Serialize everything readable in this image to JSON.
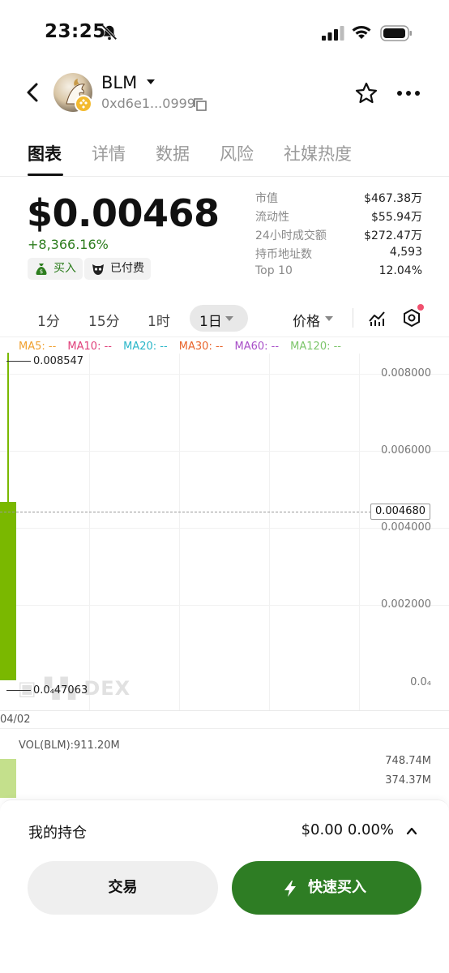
{
  "status_bar": {
    "time": "23:25"
  },
  "header": {
    "token_name": "BLM",
    "address": "0xd6e1...0999"
  },
  "tabs": [
    {
      "label": "图表",
      "active": true
    },
    {
      "label": "详情"
    },
    {
      "label": "数据"
    },
    {
      "label": "风险"
    },
    {
      "label": "社媒热度"
    }
  ],
  "price_block": {
    "price": "$0.00468",
    "change": "+8,366.16%",
    "buy_chip": "买入",
    "paid_chip": "已付费"
  },
  "stats": [
    {
      "label": "市值",
      "value": "$467.38万"
    },
    {
      "label": "流动性",
      "value": "$55.94万"
    },
    {
      "label": "24小时成交额",
      "value": "$272.47万"
    },
    {
      "label": "持币地址数",
      "value": "4,593"
    },
    {
      "label": "Top 10",
      "value": "12.04%"
    }
  ],
  "timeframes": {
    "options": [
      "1分",
      "15分",
      "1时"
    ],
    "selected": "1日",
    "price_select": "价格"
  },
  "ma_legend": [
    {
      "label": "MA5: --",
      "color": "#f0a030"
    },
    {
      "label": "MA10: --",
      "color": "#e0407a"
    },
    {
      "label": "MA20: --",
      "color": "#29b6c8"
    },
    {
      "label": "MA30: --",
      "color": "#e8642c"
    },
    {
      "label": "MA60: --",
      "color": "#a84fc8"
    },
    {
      "label": "MA120: --",
      "color": "#7cc56a"
    }
  ],
  "chart": {
    "y_labels": [
      "0.008000",
      "0.006000",
      "0.004000",
      "0.002000",
      "0.0₄"
    ],
    "high_label": "0.008547",
    "low_label": "0.0₄47063",
    "current_label": "0.004680",
    "date_label": "04/02",
    "watermark": "DEX",
    "up_color": "#7ab800"
  },
  "chart_data": {
    "type": "candlestick",
    "categories": [
      "04/02"
    ],
    "open": [
      4.71e-05
    ],
    "high": [
      0.008547
    ],
    "low": [
      4.71e-05
    ],
    "close": [
      0.00468
    ],
    "ylim": [
      0,
      0.0085
    ],
    "volume": {
      "label": "VOL(BLM):911.20M",
      "values": [
        911.2
      ],
      "ticks": [
        "748.74M",
        "374.37M"
      ]
    }
  },
  "holding": {
    "label": "我的持仓",
    "value": "$0.00 0.00%"
  },
  "actions": {
    "trade": "交易",
    "quick_buy": "快速买入"
  }
}
